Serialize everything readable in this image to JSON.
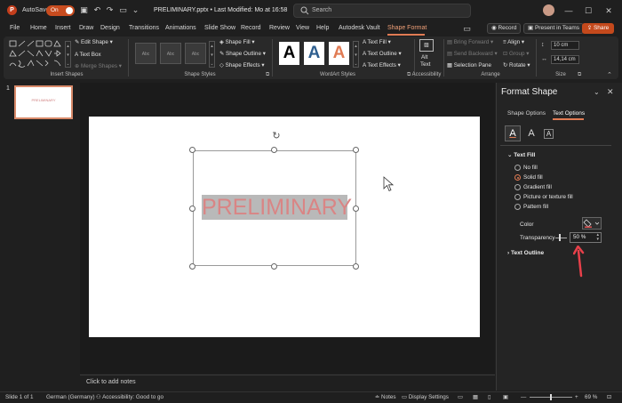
{
  "titlebar": {
    "autosave_label": "AutoSave",
    "autosave_state": "On",
    "doc_title": "PRELIMINARY.pptx • Last Modified: Mo at 16:58",
    "search_placeholder": "Search",
    "record_label": "Record",
    "present_label": "Present in Teams",
    "share_label": "Share"
  },
  "tabs": [
    "File",
    "Home",
    "Insert",
    "Draw",
    "Design",
    "Transitions",
    "Animations",
    "Slide Show",
    "Record",
    "Review",
    "View",
    "Help",
    "Autodesk Vault",
    "Shape Format"
  ],
  "ribbon": {
    "insert_shapes": {
      "edit_shape": "Edit Shape",
      "text_box": "Text Box",
      "merge_shapes": "Merge Shapes",
      "label": "Insert Shapes"
    },
    "shape_styles": {
      "thumb_text": "Abc",
      "shape_fill": "Shape Fill",
      "shape_outline": "Shape Outline",
      "shape_effects": "Shape Effects",
      "label": "Shape Styles"
    },
    "wordart": {
      "letter": "A",
      "text_fill": "Text Fill",
      "text_outline": "Text Outline",
      "text_effects": "Text Effects",
      "label": "WordArt Styles",
      "colors": [
        "#000000",
        "#2f5f8f",
        "#e07b54"
      ]
    },
    "accessibility": {
      "alt_text_line1": "Alt",
      "alt_text_line2": "Text",
      "label": "Accessibility"
    },
    "arrange": {
      "bring_forward": "Bring Forward",
      "send_backward": "Send Backward",
      "selection_pane": "Selection Pane",
      "align": "Align",
      "group": "Group",
      "rotate": "Rotate",
      "label": "Arrange"
    },
    "size": {
      "height": "10 cm",
      "width": "14,14 cm",
      "label": "Size"
    }
  },
  "thumbnails": {
    "number": "1",
    "text": "PRELIMINARY"
  },
  "slide": {
    "text": "PRELIMINARY"
  },
  "notes": {
    "placeholder": "Click to add notes"
  },
  "format_pane": {
    "title": "Format Shape",
    "tab_shape_options": "Shape Options",
    "tab_text_options": "Text Options",
    "section_text_fill": "Text Fill",
    "fill_options": [
      {
        "label": "No fill",
        "selected": false
      },
      {
        "label": "Solid fill",
        "selected": true
      },
      {
        "label": "Gradient fill",
        "selected": false
      },
      {
        "label": "Picture or texture fill",
        "selected": false
      },
      {
        "label": "Pattern fill",
        "selected": false
      }
    ],
    "color_label": "Color",
    "transparency_label": "Transparency",
    "transparency_value": "50 %",
    "section_text_outline": "Text Outline"
  },
  "statusbar": {
    "slide_count": "Slide 1 of 1",
    "language": "German (Germany)",
    "accessibility": "Accessibility: Good to go",
    "notes": "Notes",
    "display_settings": "Display Settings",
    "zoom": "69 %"
  },
  "colors": {
    "accent": "#e07b54",
    "share": "#c4491c",
    "preliminary_text": "#d98585"
  }
}
